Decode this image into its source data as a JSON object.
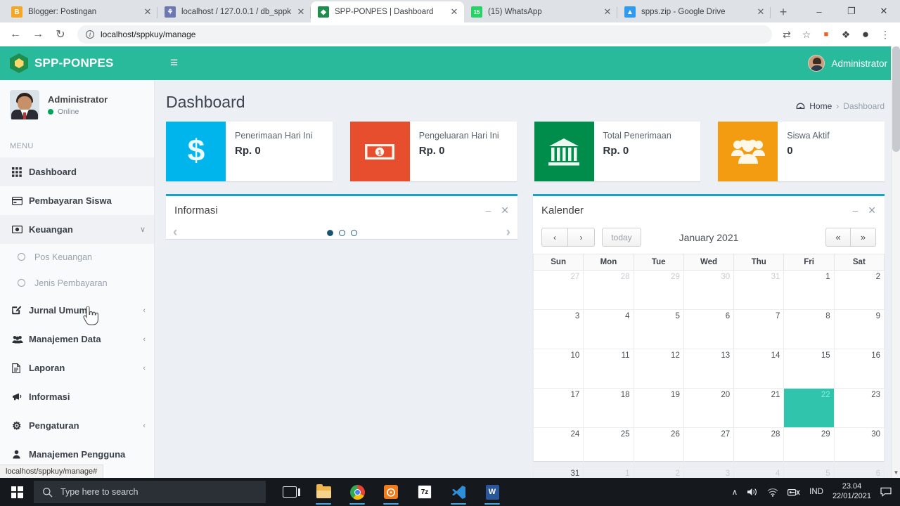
{
  "browser": {
    "tabs": [
      {
        "title": "Blogger: Postingan",
        "favicon_name": "blogger-icon",
        "favicon_color": "#f5a623",
        "favicon_char": "B",
        "active": false
      },
      {
        "title": "localhost / 127.0.0.1 / db_sppk",
        "favicon_name": "phpmyadmin-icon",
        "favicon_color": "#6c78af",
        "favicon_char": "⚘",
        "active": false
      },
      {
        "title": "SPP-PONPES | Dashboard",
        "favicon_name": "spp-ponpes-icon",
        "favicon_color": "#1f8e4d",
        "favicon_char": "◆",
        "active": true
      },
      {
        "title": "(15) WhatsApp",
        "favicon_name": "whatsapp-icon",
        "favicon_color": "#25d366",
        "favicon_char": "15",
        "active": false
      },
      {
        "title": "spps.zip - Google Drive",
        "favicon_name": "google-drive-icon",
        "favicon_color": "#2e9bf0",
        "favicon_char": "▲",
        "active": false
      }
    ],
    "close_label": "✕",
    "newtab_label": "+",
    "window_minimize": "–",
    "window_maximize": "❐",
    "window_close": "✕",
    "back_label": "←",
    "forward_label": "→",
    "reload_label": "↻",
    "address": "localhost/sppkuy/manage",
    "info_icon_label": "i",
    "toolbar_icons": [
      {
        "name": "translate-icon",
        "glyph": "⇄"
      },
      {
        "name": "bookmark-star-icon",
        "glyph": "☆"
      },
      {
        "name": "lastpass-icon",
        "glyph": "⬛"
      },
      {
        "name": "extensions-puzzle-icon",
        "glyph": "❖"
      },
      {
        "name": "profile-avatar-icon",
        "glyph": "●"
      },
      {
        "name": "chrome-menu-icon",
        "glyph": "⋮"
      }
    ]
  },
  "app": {
    "brand": "SPP-PONPES",
    "hamburger": "≡",
    "nav_user": "Administrator",
    "sidebar": {
      "user_name": "Administrator",
      "user_status": "Online",
      "menu_label": "MENU",
      "items": [
        {
          "label": "Dashboard",
          "icon": "grid-icon",
          "glyph": "☷",
          "arrow": "",
          "active": true,
          "sub": false
        },
        {
          "label": "Pembayaran Siswa",
          "icon": "credit-card-icon",
          "glyph": "▤",
          "arrow": "",
          "active": false,
          "sub": false
        },
        {
          "label": "Keuangan",
          "icon": "money-icon",
          "glyph": "▣",
          "arrow": "∨",
          "active": false,
          "sub": false
        },
        {
          "label": "Pos Keuangan",
          "icon": "circle-icon",
          "glyph": "",
          "arrow": "",
          "active": false,
          "sub": true
        },
        {
          "label": "Jenis Pembayaran",
          "icon": "circle-icon",
          "glyph": "",
          "arrow": "",
          "active": false,
          "sub": true
        },
        {
          "label": "Jurnal Umum",
          "icon": "edit-icon",
          "glyph": "✎",
          "arrow": "‹",
          "active": false,
          "sub": false
        },
        {
          "label": "Manajemen Data",
          "icon": "users-icon",
          "glyph": "♣",
          "arrow": "‹",
          "active": false,
          "sub": false
        },
        {
          "label": "Laporan",
          "icon": "document-icon",
          "glyph": "☷",
          "arrow": "‹",
          "active": false,
          "sub": false
        },
        {
          "label": "Informasi",
          "icon": "megaphone-icon",
          "glyph": "◀",
          "arrow": "",
          "active": false,
          "sub": false
        },
        {
          "label": "Pengaturan",
          "icon": "gear-icon",
          "glyph": "⚙",
          "arrow": "‹",
          "active": false,
          "sub": false
        },
        {
          "label": "Manajemen Pengguna",
          "icon": "user-icon",
          "glyph": "♟",
          "arrow": "",
          "active": false,
          "sub": false
        }
      ],
      "status_bar_url": "localhost/sppkuy/manage#"
    },
    "page_title": "Dashboard",
    "breadcrumb": {
      "home": "Home",
      "sep": "›",
      "current": "Dashboard",
      "icon": "dashboard-breadcrumb-icon"
    },
    "stats": [
      {
        "title": "Penerimaan Hari Ini",
        "value": "Rp. 0",
        "color": "#00b5ec",
        "icon": "dollar-icon"
      },
      {
        "title": "Pengeluaran Hari Ini",
        "value": "Rp. 0",
        "color": "#e64e2e",
        "icon": "banknote-icon"
      },
      {
        "title": "Total Penerimaan",
        "value": "Rp. 0",
        "color": "#008d4c",
        "icon": "bank-icon"
      },
      {
        "title": "Siswa Aktif",
        "value": "0",
        "color": "#f39c12",
        "icon": "group-icon"
      }
    ],
    "info_panel": {
      "title": "Informasi",
      "minimize": "–",
      "close": "✕",
      "prev": "‹",
      "next": "›",
      "dots": 3,
      "active_dot": 0
    },
    "calendar_panel": {
      "title": "Kalender",
      "minimize": "–",
      "close": "✕",
      "prev": "‹",
      "next": "›",
      "today": "today",
      "month": "January 2021",
      "first": "«",
      "last": "»",
      "weekdays": [
        "Sun",
        "Mon",
        "Tue",
        "Wed",
        "Thu",
        "Fri",
        "Sat"
      ],
      "weeks": [
        [
          {
            "d": "27",
            "o": true
          },
          {
            "d": "28",
            "o": true
          },
          {
            "d": "29",
            "o": true
          },
          {
            "d": "30",
            "o": true
          },
          {
            "d": "31",
            "o": true
          },
          {
            "d": "1",
            "o": false
          },
          {
            "d": "2",
            "o": false
          }
        ],
        [
          {
            "d": "3",
            "o": false
          },
          {
            "d": "4",
            "o": false
          },
          {
            "d": "5",
            "o": false
          },
          {
            "d": "6",
            "o": false
          },
          {
            "d": "7",
            "o": false
          },
          {
            "d": "8",
            "o": false
          },
          {
            "d": "9",
            "o": false
          }
        ],
        [
          {
            "d": "10",
            "o": false
          },
          {
            "d": "11",
            "o": false
          },
          {
            "d": "12",
            "o": false
          },
          {
            "d": "13",
            "o": false
          },
          {
            "d": "14",
            "o": false
          },
          {
            "d": "15",
            "o": false
          },
          {
            "d": "16",
            "o": false
          }
        ],
        [
          {
            "d": "17",
            "o": false
          },
          {
            "d": "18",
            "o": false
          },
          {
            "d": "19",
            "o": false
          },
          {
            "d": "20",
            "o": false
          },
          {
            "d": "21",
            "o": false
          },
          {
            "d": "22",
            "o": false,
            "today": true
          },
          {
            "d": "23",
            "o": false
          }
        ],
        [
          {
            "d": "24",
            "o": false
          },
          {
            "d": "25",
            "o": false
          },
          {
            "d": "26",
            "o": false
          },
          {
            "d": "27",
            "o": false
          },
          {
            "d": "28",
            "o": false
          },
          {
            "d": "29",
            "o": false
          },
          {
            "d": "30",
            "o": false
          }
        ],
        [
          {
            "d": "31",
            "o": false
          },
          {
            "d": "1",
            "o": true
          },
          {
            "d": "2",
            "o": true
          },
          {
            "d": "3",
            "o": true
          },
          {
            "d": "4",
            "o": true
          },
          {
            "d": "5",
            "o": true
          },
          {
            "d": "6",
            "o": true
          }
        ]
      ]
    }
  },
  "taskbar": {
    "search_placeholder": "Type here to search",
    "search_icon": "magnifier-icon",
    "start_icon": "windows-start-icon",
    "apps": [
      {
        "name": "task-view-icon"
      },
      {
        "name": "file-explorer-icon"
      },
      {
        "name": "google-chrome-icon"
      },
      {
        "name": "xampp-icon"
      },
      {
        "name": "7zip-icon"
      },
      {
        "name": "vscode-icon"
      },
      {
        "name": "word-icon"
      }
    ],
    "tray": {
      "chevron": "∧",
      "volume": "🔊",
      "wifi": "◠",
      "network": "⚿",
      "language": "IND",
      "time": "23.04",
      "date": "22/01/2021",
      "action_center": "▭"
    }
  }
}
